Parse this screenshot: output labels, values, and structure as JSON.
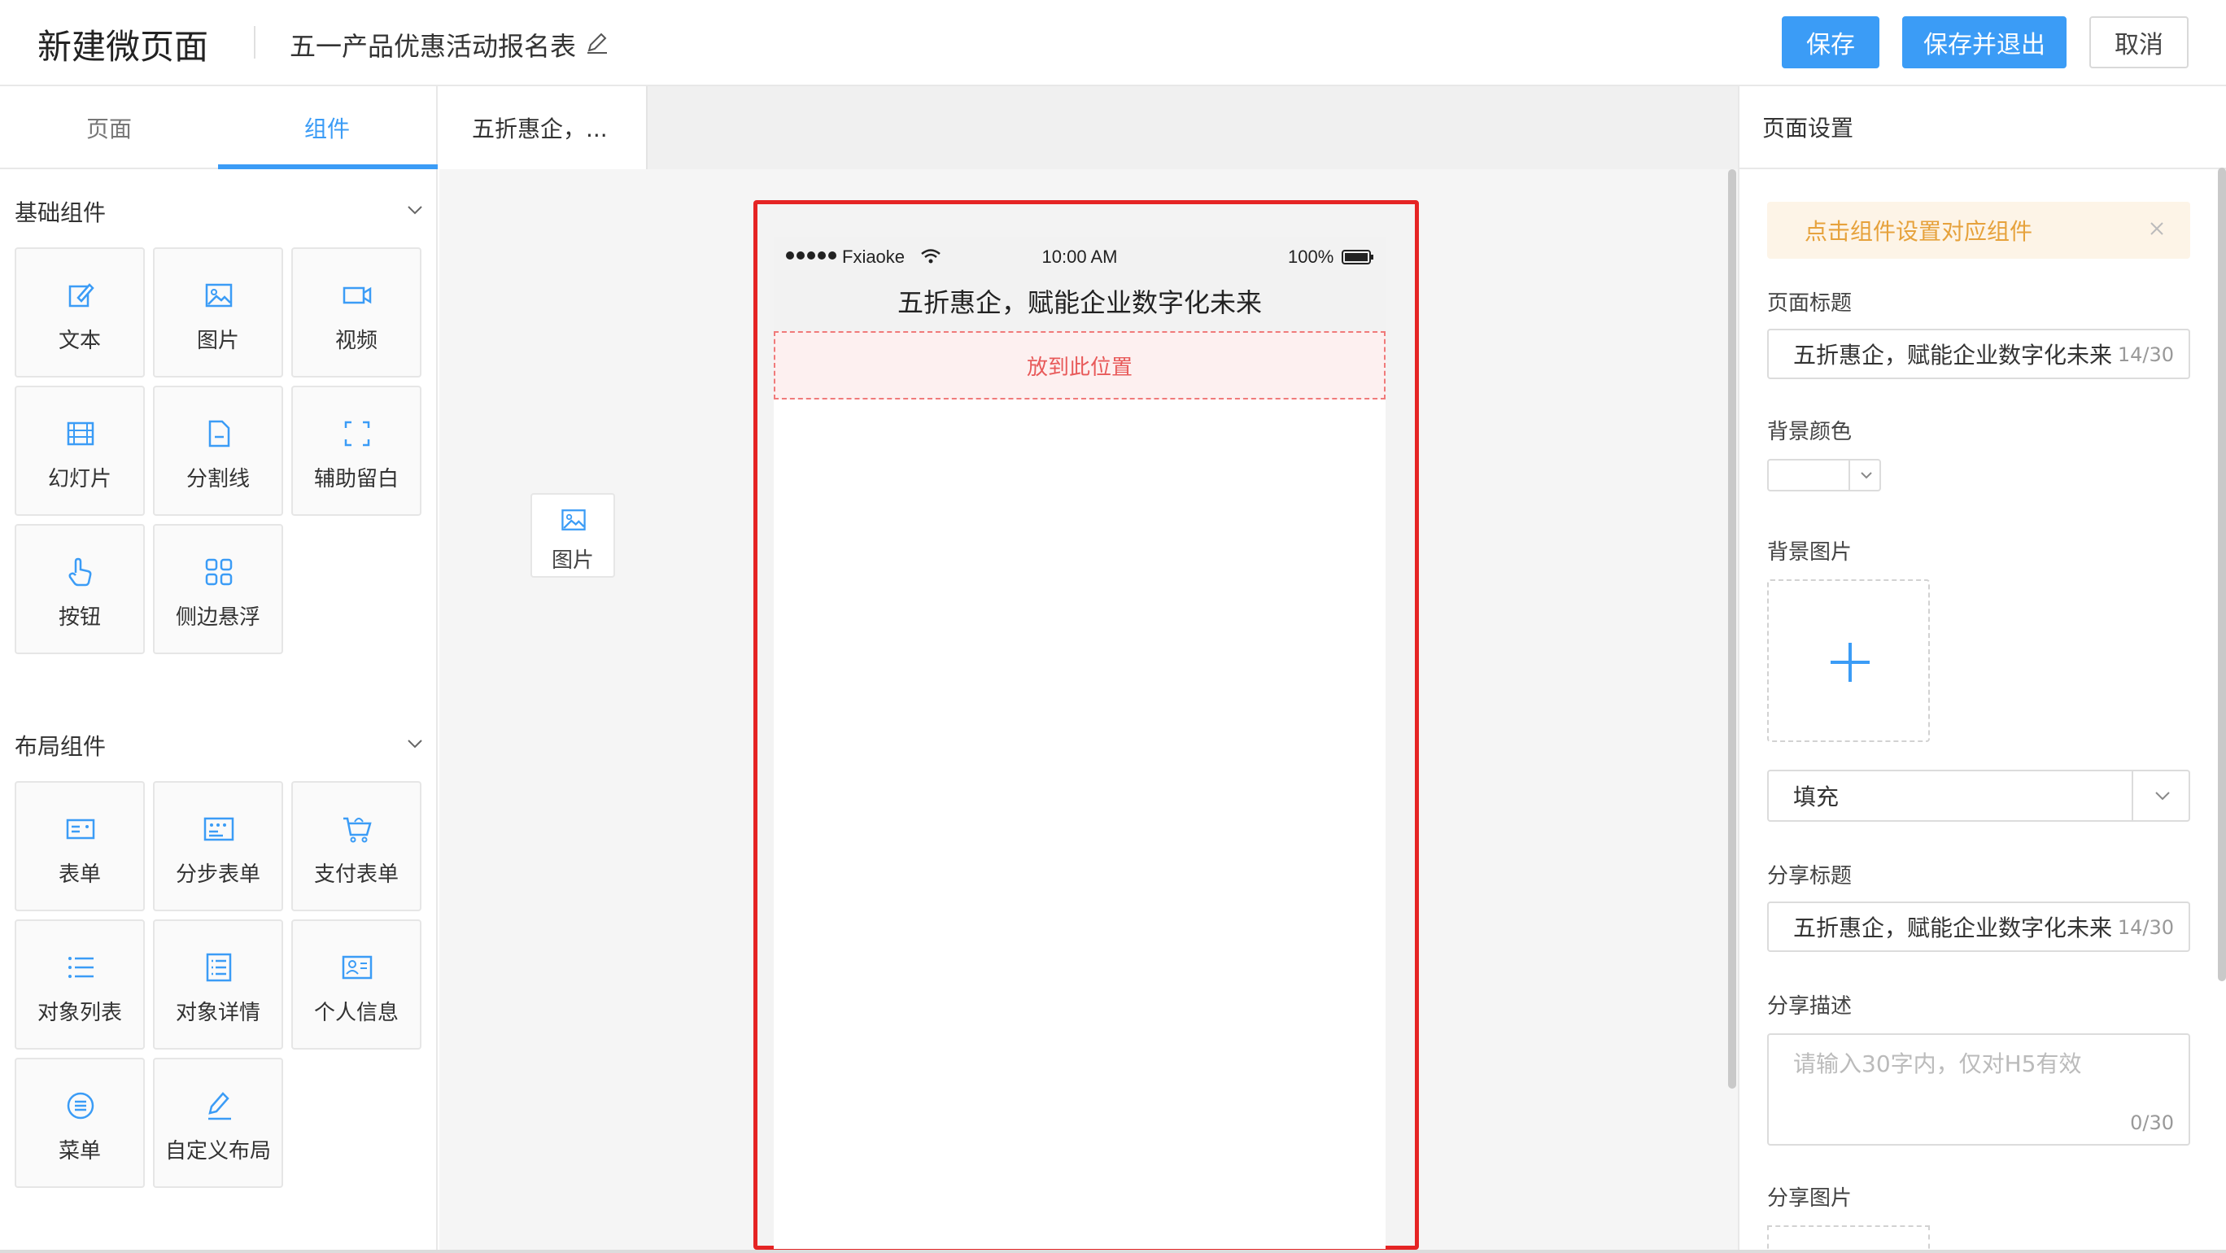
{
  "header": {
    "title": "新建微页面",
    "form_name": "五一产品优惠活动报名表",
    "buttons": {
      "save": "保存",
      "save_exit": "保存并退出",
      "cancel": "取消"
    }
  },
  "left_panel": {
    "tabs": [
      {
        "label": "页面"
      },
      {
        "label": "组件"
      }
    ],
    "active_tab": "组件",
    "basic_section": {
      "title": "基础组件",
      "items": [
        {
          "label": "文本",
          "icon": "edit-icon"
        },
        {
          "label": "图片",
          "icon": "image-icon"
        },
        {
          "label": "视频",
          "icon": "video-icon"
        },
        {
          "label": "幻灯片",
          "icon": "slideshow-icon"
        },
        {
          "label": "分割线",
          "icon": "document-icon"
        },
        {
          "label": "辅助留白",
          "icon": "expand-icon"
        },
        {
          "label": "按钮",
          "icon": "hand-pointer-icon"
        },
        {
          "label": "侧边悬浮",
          "icon": "grid-icon"
        }
      ]
    },
    "layout_section": {
      "title": "布局组件",
      "items": [
        {
          "label": "表单",
          "icon": "form-icon"
        },
        {
          "label": "分步表单",
          "icon": "step-form-icon"
        },
        {
          "label": "支付表单",
          "icon": "cart-icon"
        },
        {
          "label": "对象列表",
          "icon": "list-icon"
        },
        {
          "label": "对象详情",
          "icon": "detail-icon"
        },
        {
          "label": "个人信息",
          "icon": "id-card-icon"
        },
        {
          "label": "菜单",
          "icon": "menu-icon"
        },
        {
          "label": "自定义布局",
          "icon": "pen-icon"
        }
      ]
    }
  },
  "canvas": {
    "tab_label": "五折惠企，...",
    "dragging_item": {
      "label": "图片",
      "icon": "image-icon"
    },
    "phone": {
      "carrier": "Fxiaoke",
      "time": "10:00 AM",
      "battery": "100%",
      "page_title": "五折惠企，赋能企业数字化未来",
      "dropzone_text": "放到此位置"
    },
    "highlight_color": "#e52424"
  },
  "right_panel": {
    "title": "页面设置",
    "alert": "点击组件设置对应组件",
    "page_title_label": "页面标题",
    "page_title_value": "五折惠企，赋能企业数字化未来",
    "page_title_count": "14/30",
    "bg_color_label": "背景颜色",
    "bg_image_label": "背景图片",
    "fill_mode": "填充",
    "share_title_label": "分享标题",
    "share_title_value": "五折惠企，赋能企业数字化未来",
    "share_title_count": "14/30",
    "share_desc_label": "分享描述",
    "share_desc_placeholder": "请输入30字内，仅对H5有效",
    "share_desc_count": "0/30",
    "share_image_label": "分享图片"
  },
  "colors": {
    "primary": "#3b9cf6",
    "danger": "#e52424",
    "warning": "#e6a23c"
  }
}
